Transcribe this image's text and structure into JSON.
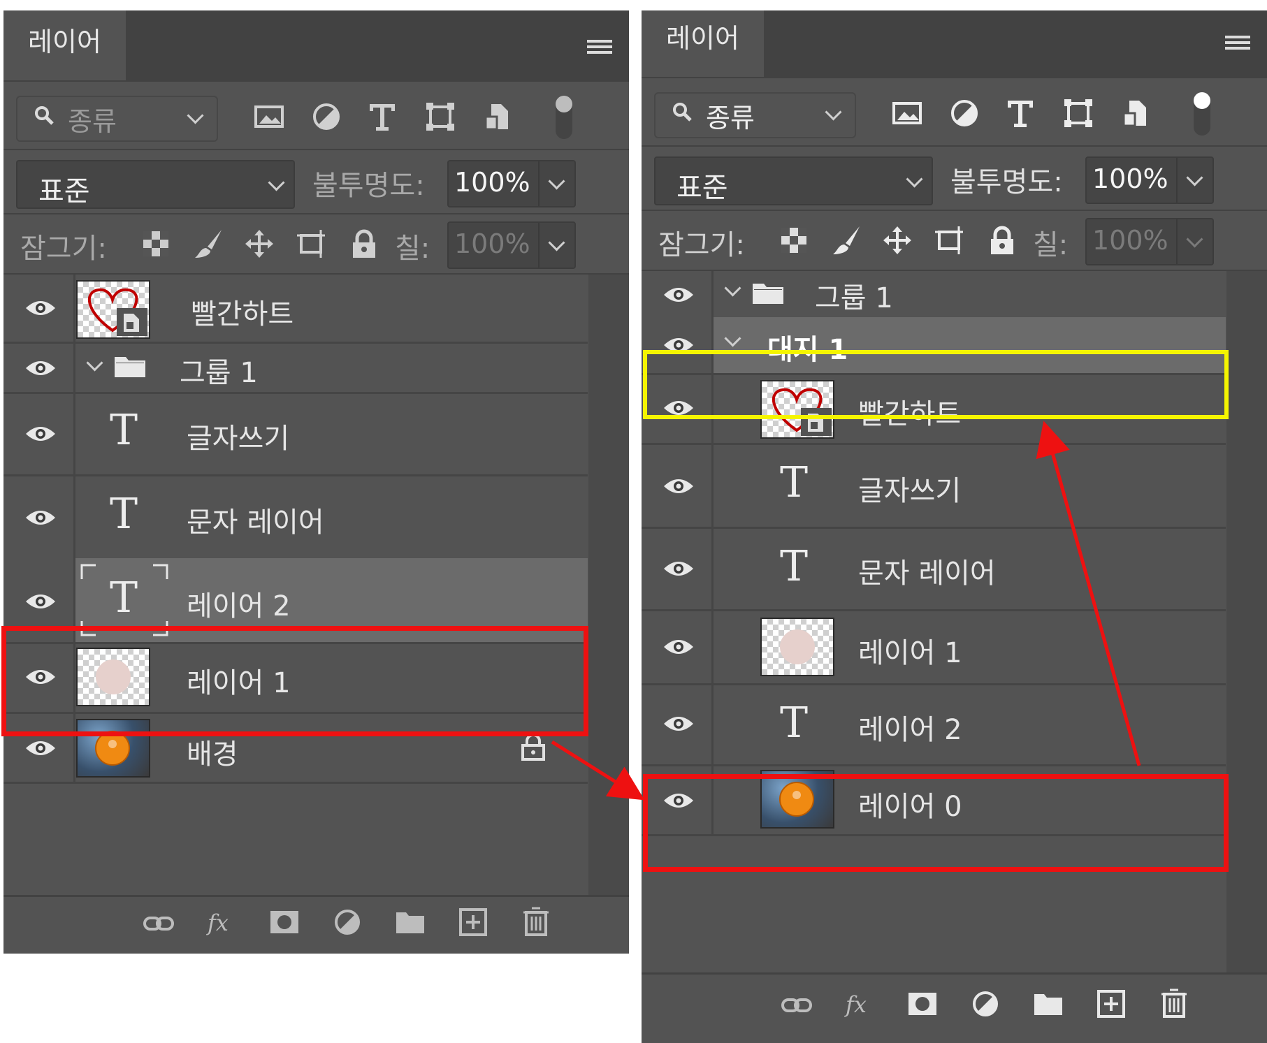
{
  "left_panel": {
    "tab_label": "레이어",
    "filter": {
      "kind_label": "종류"
    },
    "blend_mode": "표준",
    "opacity_label": "불투명도:",
    "opacity_value": "100%",
    "lock_label": "잠그기:",
    "fill_label": "칠:",
    "fill_value": "100%",
    "layers": [
      {
        "name": "빨간하트",
        "kind": "smart-object-heart"
      },
      {
        "name": "그룹 1",
        "kind": "group"
      },
      {
        "name": "글자쓰기",
        "kind": "text"
      },
      {
        "name": "문자 레이어",
        "kind": "text"
      },
      {
        "name": "레이어 2",
        "kind": "text",
        "selected": true
      },
      {
        "name": "레이어 1",
        "kind": "pixel-circle"
      },
      {
        "name": "배경",
        "kind": "photo",
        "locked": true
      }
    ]
  },
  "right_panel": {
    "tab_label": "레이어",
    "filter": {
      "kind_label": "종류"
    },
    "blend_mode": "표준",
    "opacity_label": "불투명도:",
    "opacity_value": "100%",
    "lock_label": "잠그기:",
    "fill_label": "칠:",
    "fill_value": "100%",
    "layers": [
      {
        "name": "그룹 1",
        "kind": "group"
      },
      {
        "name": "대지 1",
        "kind": "artboard",
        "selected": true
      },
      {
        "name": "빨간하트",
        "kind": "smart-object-heart"
      },
      {
        "name": "글자쓰기",
        "kind": "text"
      },
      {
        "name": "문자 레이어",
        "kind": "text"
      },
      {
        "name": "레이어 1",
        "kind": "pixel-circle"
      },
      {
        "name": "레이어 2",
        "kind": "text"
      },
      {
        "name": "레이어 0",
        "kind": "photo"
      }
    ]
  },
  "annotation_colors": {
    "red": "#ee1111",
    "yellow": "#f5f500"
  },
  "text_glyph": "T"
}
